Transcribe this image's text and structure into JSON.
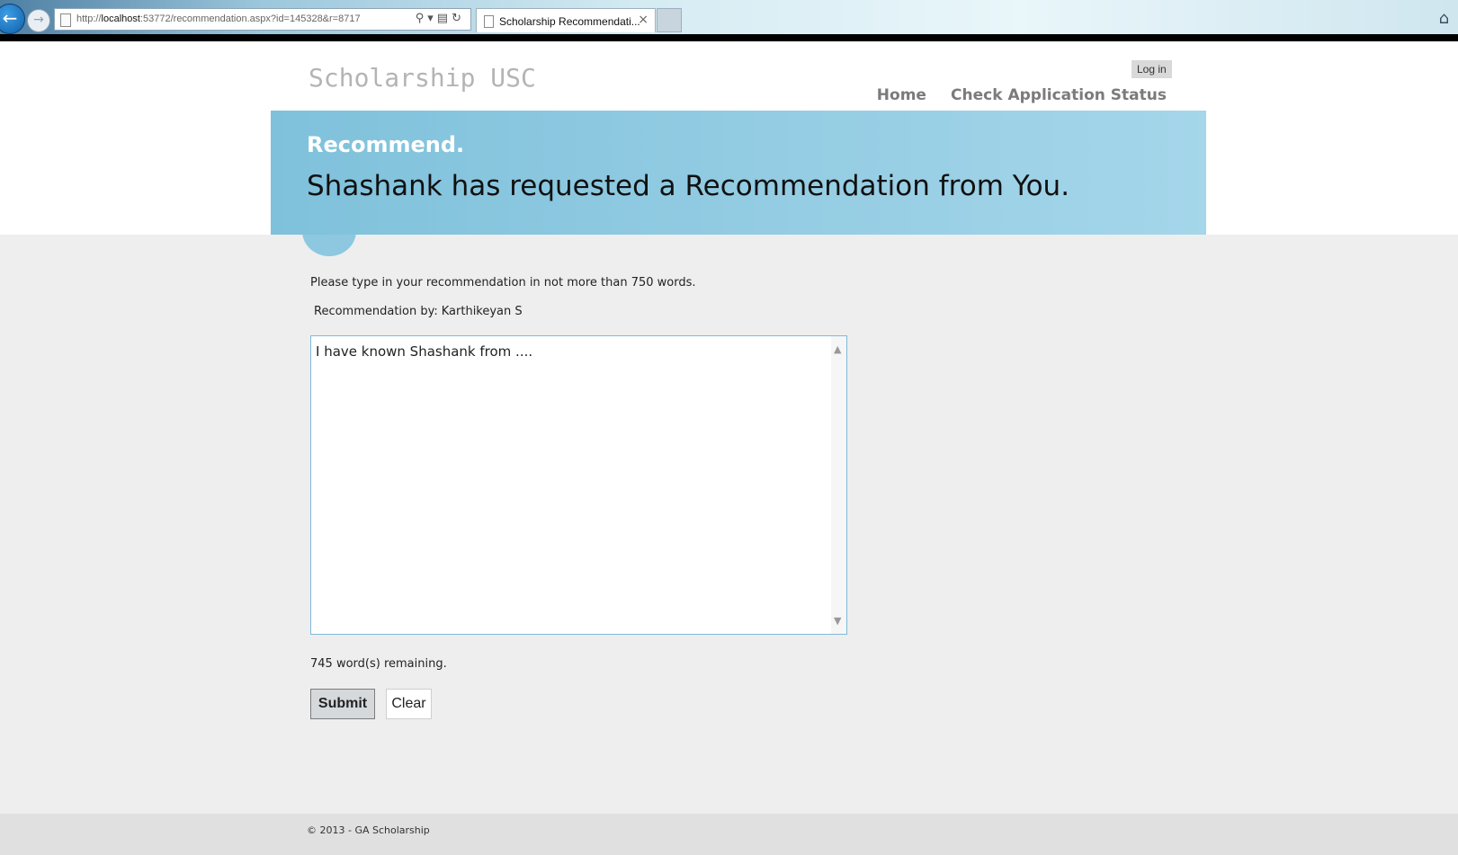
{
  "browser": {
    "url_prefix": "http://",
    "url_host": "localhost",
    "url_rest": ":53772/recommendation.aspx?id=145328&r=8717",
    "tab_title": "Scholarship Recommendati...",
    "tab_close": "×"
  },
  "site": {
    "title": "Scholarship USC",
    "login_label": "Log in",
    "nav": [
      {
        "label": "Home"
      },
      {
        "label": "Check Application Status"
      }
    ]
  },
  "banner": {
    "title": "Recommend.",
    "subtitle": "Shashank has requested a Recommendation from You."
  },
  "form": {
    "instructions": "Please type in your recommendation in not more than 750 words.",
    "byline_label": "Recommendation by:",
    "byline_name": "Karthikeyan S",
    "recommendation_text": "I have known Shashank from ....",
    "words_remaining": "745 word(s) remaining.",
    "submit_label": "Submit",
    "clear_label": "Clear"
  },
  "footer": {
    "copyright": "© 2013 - GA Scholarship"
  },
  "icons": {
    "back": "back-arrow-icon",
    "forward": "forward-arrow-icon",
    "home": "home-icon"
  },
  "colors": {
    "banner_start": "#7fc1db",
    "banner_end": "#a5d6ea",
    "page_bg": "#eeeeee",
    "footer_bg": "#e0e0e0"
  }
}
